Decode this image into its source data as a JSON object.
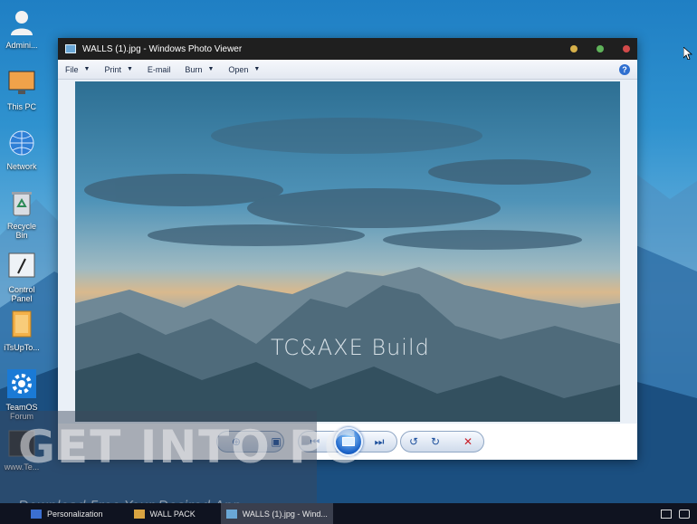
{
  "desktop": {
    "icons": [
      {
        "label": "Admini...",
        "icon": "user-icon"
      },
      {
        "label": "This PC",
        "icon": "computer-icon"
      },
      {
        "label": "Network",
        "icon": "network-icon"
      },
      {
        "label": "Recycle Bin",
        "icon": "recycle-bin-icon"
      },
      {
        "label": "Control Panel",
        "icon": "control-panel-icon"
      },
      {
        "label": "iTsUpTo...",
        "icon": "folder-icon"
      },
      {
        "label": "TeamOS Forum",
        "icon": "gear-icon"
      },
      {
        "label": "www.Te...",
        "icon": "shortcut-icon"
      }
    ]
  },
  "window": {
    "title": "WALLS (1).jpg - Windows Photo Viewer",
    "menu": [
      {
        "label": "File",
        "has_dropdown": true
      },
      {
        "label": "Print",
        "has_dropdown": true
      },
      {
        "label": "E-mail",
        "has_dropdown": false
      },
      {
        "label": "Burn",
        "has_dropdown": true
      },
      {
        "label": "Open",
        "has_dropdown": true
      }
    ],
    "help_label": "?",
    "photo_watermark": "TC&AXE Build",
    "controls": [
      "zoom-icon",
      "actual-size-icon",
      "previous-icon",
      "slideshow-icon",
      "next-icon",
      "rotate-left-icon",
      "rotate-right-icon",
      "delete-icon"
    ],
    "title_dots": [
      "#d6b04a",
      "#5fb35a",
      "#d24a4a"
    ]
  },
  "overlay": {
    "brand": "GET INTO PC",
    "tagline": "Download Free Your Desired App"
  },
  "taskbar": {
    "items": [
      {
        "label": "Personalization",
        "active": false
      },
      {
        "label": "WALL PACK",
        "active": false
      },
      {
        "label": "WALLS (1).jpg - Wind...",
        "active": true
      }
    ]
  }
}
